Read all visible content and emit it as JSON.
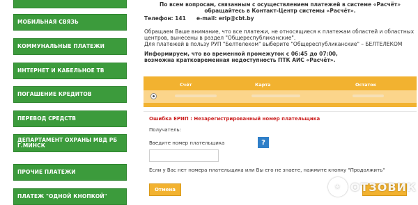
{
  "sidebar": {
    "items": [
      {
        "label": ""
      },
      {
        "label": "Мобильная связь"
      },
      {
        "label": "Коммунальные платежи"
      },
      {
        "label": "Интернет и кабельное ТВ"
      },
      {
        "label": "Погашение кредитов"
      },
      {
        "label": "Перевод средств"
      },
      {
        "label": "Департамент охраны МВД РБ г.Минск"
      },
      {
        "label": "Прочие платежи"
      },
      {
        "label": "Платеж \"одной кнопкой\""
      }
    ]
  },
  "info": {
    "line1": "По всем вопросам, связанным с осуществлением платежей в системе «Расчёт» обращайтесь в Контакт-Центр системы «Расчёт».",
    "phone": "Телефон: 141",
    "email": "e-mail: erip@cbt.by",
    "notice": "Обращаем Ваше внимание, что все платежи, не относящиеся к платежам областей и областных центров, вынесены в раздел \"Общереспубликанские\".",
    "beltelecom": "Для платежей в пользу РУП \"Белтелеком\" выберите \"Общереспубликанские\" – БЕЛТЕЛЕКОМ",
    "maintenance": "Информируем, что во временной промежуток с 06:45 до 07:00, возможна кратковременная недоступность ПТК АИС «Расчёт»."
  },
  "accounts": {
    "columns": [
      "Счёт",
      "Карта",
      "Остаток"
    ]
  },
  "form": {
    "error": "Ошибка ЕРИП : Незарегистрированный номер плательщика",
    "recipient_label": "Получатель:",
    "payer_number_label": "Введите номер плательщика",
    "payer_number_value": "",
    "help_symbol": "?",
    "hint": "Если у Вас нет номера плательщика или Вы его не знаете, нажмите кнопку \"Продолжить\"",
    "cancel_label": "Отмена"
  },
  "watermark": {
    "text": "ОТЗОВИК"
  },
  "colors": {
    "nav_green": "#3c9b3c",
    "accent_orange": "#f2b230",
    "error_red": "#cc2222",
    "help_blue": "#2f7fc8"
  }
}
